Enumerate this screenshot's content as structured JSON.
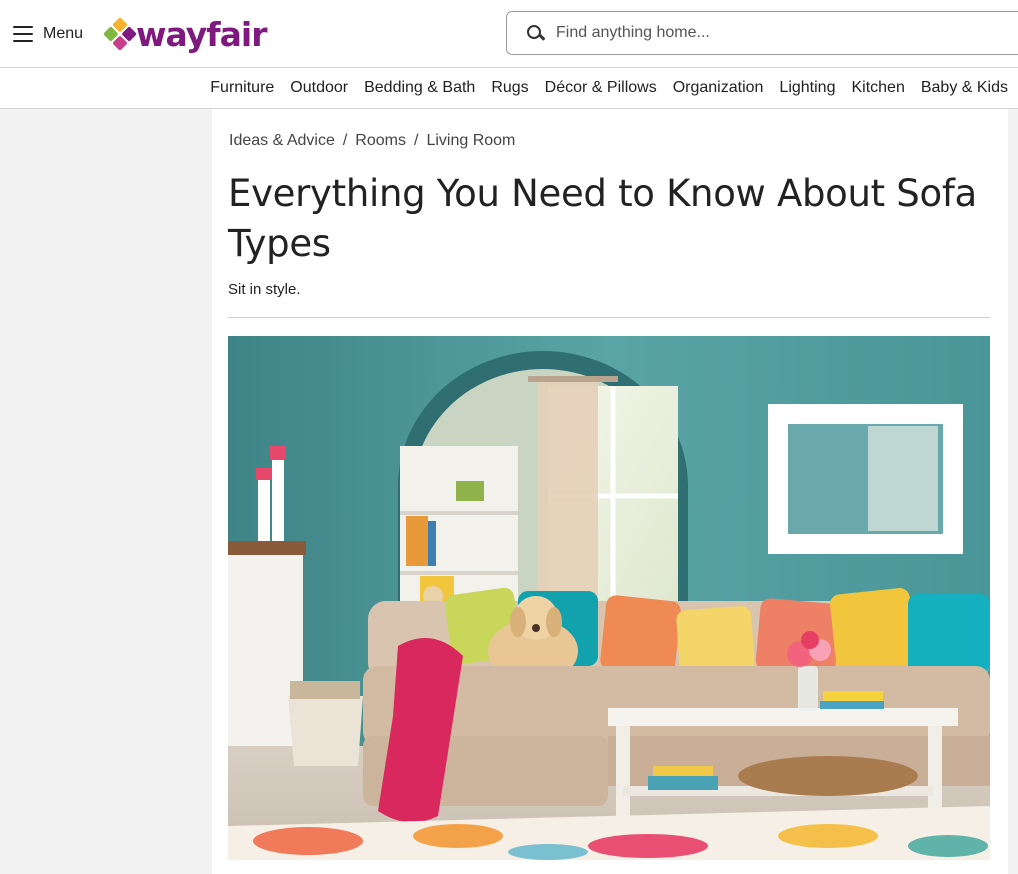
{
  "header": {
    "menu_label": "Menu",
    "logo_text": "wayfair",
    "search_placeholder": "Find anything home..."
  },
  "nav": {
    "items": [
      "Furniture",
      "Outdoor",
      "Bedding & Bath",
      "Rugs",
      "Décor & Pillows",
      "Organization",
      "Lighting",
      "Kitchen",
      "Baby & Kids"
    ]
  },
  "breadcrumb": {
    "items": [
      "Ideas & Advice",
      "Rooms",
      "Living Room"
    ],
    "separator": "/"
  },
  "article": {
    "title": "Everything You Need to Know About Sofa Types",
    "subtitle": "Sit in style."
  },
  "colors": {
    "brand": "#7f187f",
    "wall": "#4f9a9c",
    "sofa": "#d9c4b0"
  }
}
